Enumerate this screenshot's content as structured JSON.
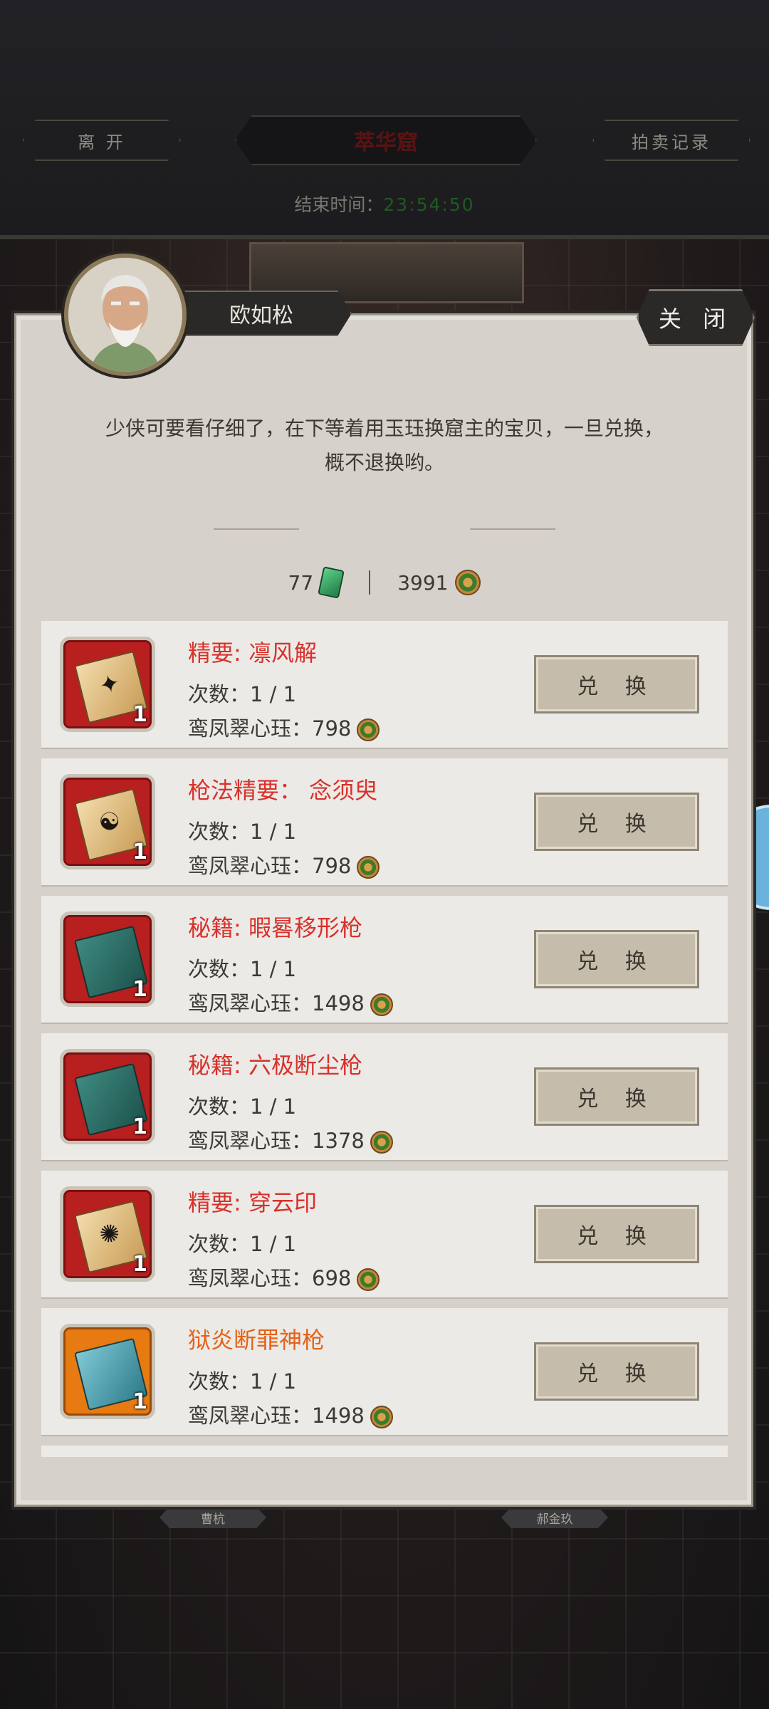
{
  "topbar": {
    "leave_label": "离 开",
    "title": "萃华窟",
    "records_label": "拍卖记录",
    "endtime_label": "结束时间：",
    "endtime_value": "23:54:50"
  },
  "board_tags": [
    "曹杭",
    "郝金玖"
  ],
  "dialog": {
    "npc_name": "欧如松",
    "close_label": "关 闭",
    "message_line1": "少侠可要看仔细了，在下等着用玉珏换窟主的宝贝，一旦兑换，",
    "message_line2": "概不退换哟。",
    "currency": {
      "jade_amount": "77",
      "coin_amount": "3991"
    }
  },
  "items": [
    {
      "name": "精要: 凛风解",
      "count": "1",
      "times": "次数：1 / 1",
      "cost_label": "鸾凤翠心珏：",
      "cost": "798",
      "button": "兑 换",
      "rarity": "red",
      "book": "gold",
      "glyph": "✦"
    },
    {
      "name": "枪法精要： 念须臾",
      "count": "1",
      "times": "次数：1 / 1",
      "cost_label": "鸾凤翠心珏：",
      "cost": "798",
      "button": "兑 换",
      "rarity": "red",
      "book": "gold",
      "glyph": "☯"
    },
    {
      "name": "秘籍: 暇晷移形枪",
      "count": "1",
      "times": "次数：1 / 1",
      "cost_label": "鸾凤翠心珏：",
      "cost": "1498",
      "button": "兑 换",
      "rarity": "red",
      "book": "green",
      "glyph": ""
    },
    {
      "name": "秘籍: 六极断尘枪",
      "count": "1",
      "times": "次数：1 / 1",
      "cost_label": "鸾凤翠心珏：",
      "cost": "1378",
      "button": "兑 换",
      "rarity": "red",
      "book": "green",
      "glyph": ""
    },
    {
      "name": "精要: 穿云印",
      "count": "1",
      "times": "次数：1 / 1",
      "cost_label": "鸾凤翠心珏：",
      "cost": "698",
      "button": "兑 换",
      "rarity": "red",
      "book": "gold",
      "glyph": "✺"
    },
    {
      "name": "狱炎断罪神枪",
      "count": "1",
      "times": "次数：1 / 1",
      "cost_label": "鸾凤翠心珏：",
      "cost": "1498",
      "button": "兑 换",
      "rarity": "orange",
      "book": "teal",
      "glyph": ""
    }
  ]
}
